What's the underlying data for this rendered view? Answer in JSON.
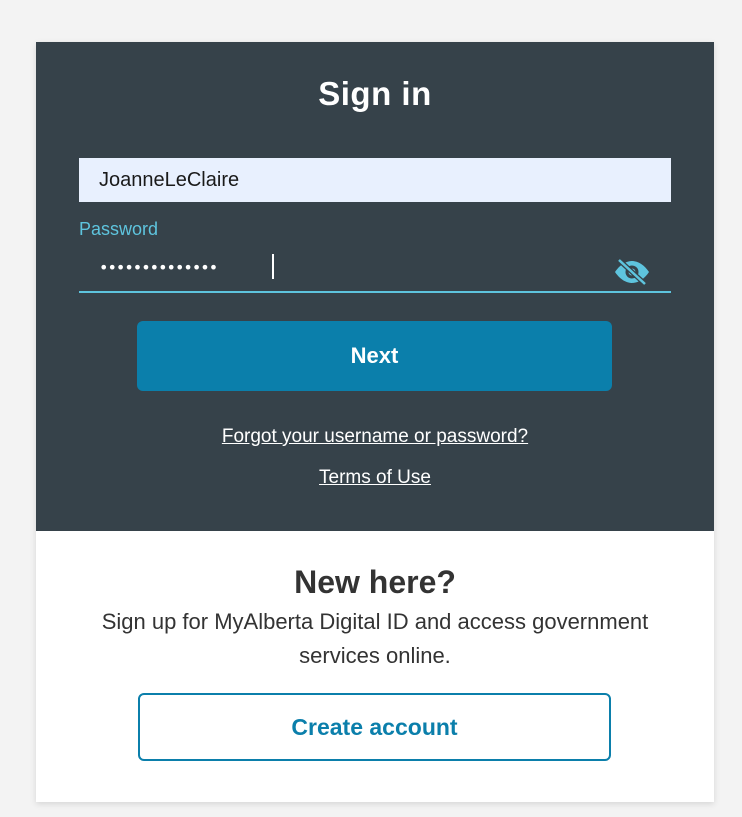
{
  "signin": {
    "title": "Sign in",
    "username_value": "JoanneLeClaire",
    "password_label": "Password",
    "password_value": "••••••••••••••",
    "password_visibility_icon": "eye-slash-icon",
    "next_label": "Next",
    "forgot_link": "Forgot your username or password?",
    "terms_link": "Terms of Use"
  },
  "signup": {
    "title": "New here?",
    "description": "Sign up for MyAlberta Digital ID and access government services online.",
    "create_account_label": "Create account"
  },
  "colors": {
    "panel_background": "#36424a",
    "accent_blue": "#0b7fab",
    "focus_cyan": "#5ec4de",
    "autofill_background": "#e8f0fe"
  }
}
